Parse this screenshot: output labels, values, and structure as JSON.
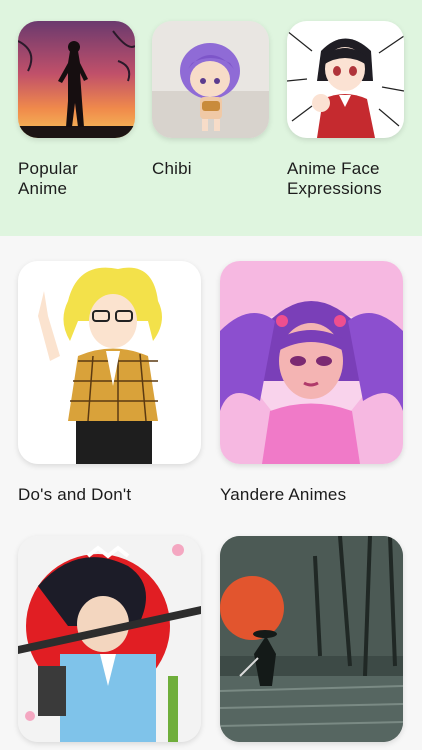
{
  "categories_top": [
    {
      "label": "Popular\nAnime",
      "image": "silhouette-sunset"
    },
    {
      "label": "Chibi",
      "image": "chibi-figure"
    },
    {
      "label": "Anime Face\nExpressions",
      "image": "pointing-girl"
    }
  ],
  "categories_grid": [
    {
      "label": "Do's and Don't",
      "image": "blonde-girl-plaid-jacket"
    },
    {
      "label": "Yandere Animes",
      "image": "purple-twintail-girl"
    },
    {
      "label": "",
      "image": "samurai-red-sun"
    },
    {
      "label": "",
      "image": "swordsman-forest"
    }
  ],
  "colors": {
    "top_band": "#dff5df",
    "background": "#f7f7f7"
  }
}
